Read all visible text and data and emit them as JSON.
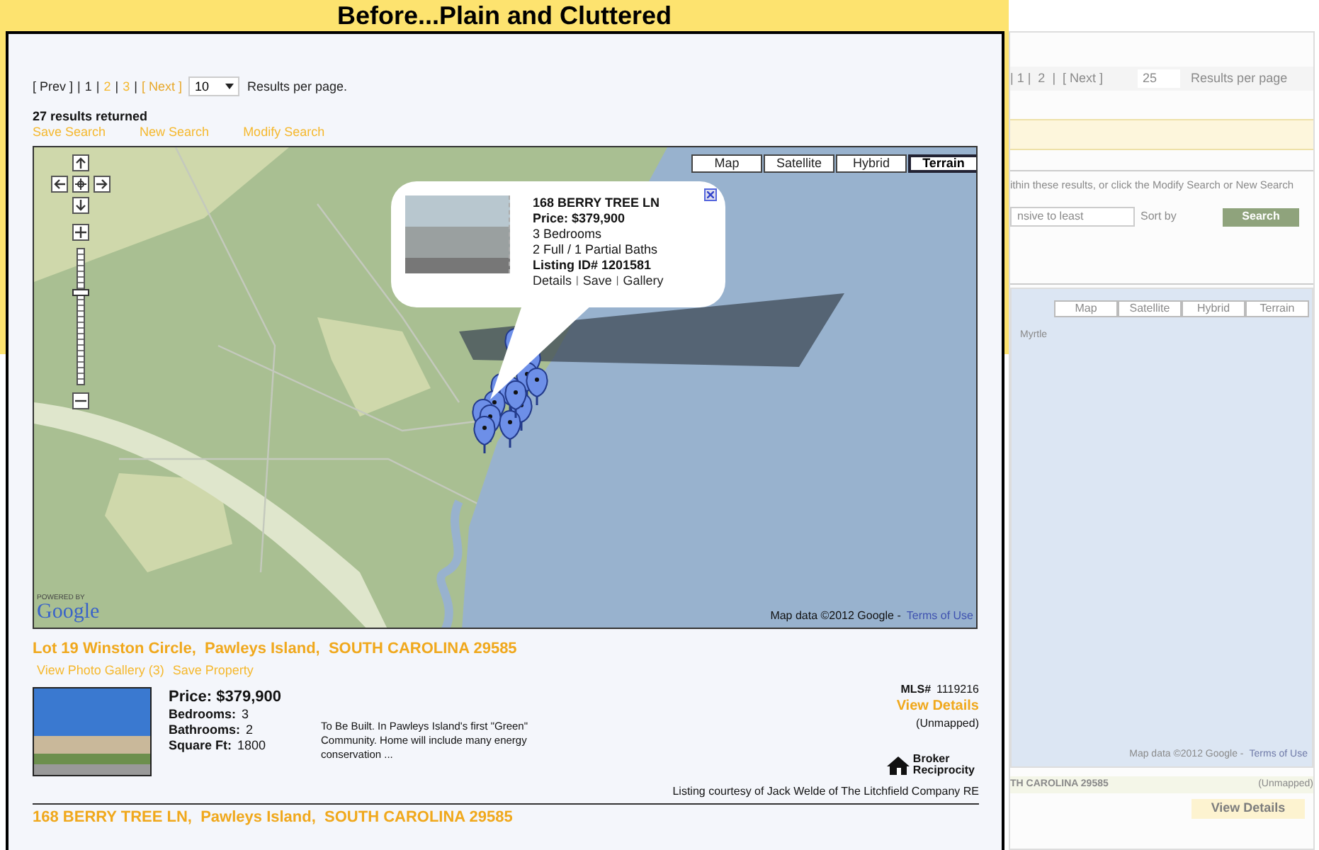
{
  "banner": {
    "title": "Before...Plain and Cluttered"
  },
  "pagination": {
    "prev": {
      "label": "[ Prev ]",
      "disabled": true
    },
    "separator": "|",
    "pages": [
      {
        "label": "1",
        "selected": true
      },
      {
        "label": "2",
        "selected": false
      },
      {
        "label": "3",
        "selected": false
      }
    ],
    "next": {
      "label": "[ Next ]",
      "disabled": false
    },
    "per_page": "10",
    "per_page_label": "Results per page."
  },
  "results_count": "27 results returned",
  "search_links": [
    "Save Search",
    "New Search",
    "Modify Search"
  ],
  "map": {
    "types": [
      {
        "label": "Map",
        "selected": false
      },
      {
        "label": "Satellite",
        "selected": false
      },
      {
        "label": "Hybrid",
        "selected": false
      },
      {
        "label": "Terrain",
        "selected": true
      }
    ],
    "zoom_slider": {
      "level": 0.68
    },
    "info_window": {
      "address": "168 BERRY TREE LN",
      "price": "Price: $379,900",
      "bedrooms": "3 Bedrooms",
      "baths": "2 Full / 1 Partial Baths",
      "listing_id": "Listing ID# 1201581",
      "links": [
        "Details",
        "Save",
        "Gallery"
      ],
      "link_separator": "|"
    },
    "powered_by": "POWERED BY",
    "logo": "Google",
    "attribution": "Map data ©2012 Google -",
    "terms": "Terms of Use"
  },
  "listings": [
    {
      "title": "Lot 19 Winston Circle,  Pawleys Island,  SOUTH CAROLINA 29585",
      "links": [
        "View Photo Gallery (3)",
        "Save Property"
      ],
      "price": "Price: $379,900",
      "facts": [
        {
          "label": "Bedrooms:",
          "value": "3"
        },
        {
          "label": "Bathrooms:",
          "value": "2"
        },
        {
          "label": "Square Ft:",
          "value": "1800"
        }
      ],
      "description": "To Be Built. In Pawleys Island's first \"Green\" Community. Home will include many energy conservation ...",
      "mls_label": "MLS#",
      "mls": "1119216",
      "details": "View Details",
      "map_status": "(Unmapped)",
      "broker_logo": [
        "Broker",
        "Reciprocity"
      ],
      "courtesy": "Listing courtesy of Jack Welde of The Litchfield Company RE"
    },
    {
      "title": "168 BERRY TREE LN,  Pawleys Island,  SOUTH CAROLINA 29585"
    }
  ],
  "after_panel": {
    "pagination": "| 1 |  2  |  [ Next ]",
    "per_page": "25",
    "per_page_label": "Results per page",
    "hint": "ithin these results, or click the Modify Search or New Search",
    "sort_value": "nsive to least",
    "sort_label": "Sort by",
    "search_button": "Search",
    "map_types": [
      "Map",
      "Satellite",
      "Hybrid",
      "Terrain"
    ],
    "map_label": "Myrtle",
    "attribution": "Map data ©2012 Google -",
    "terms": "Terms of Use",
    "listing_title": "TH CAROLINA 29585",
    "map_status": "(Unmapped)",
    "details": "View Details"
  }
}
